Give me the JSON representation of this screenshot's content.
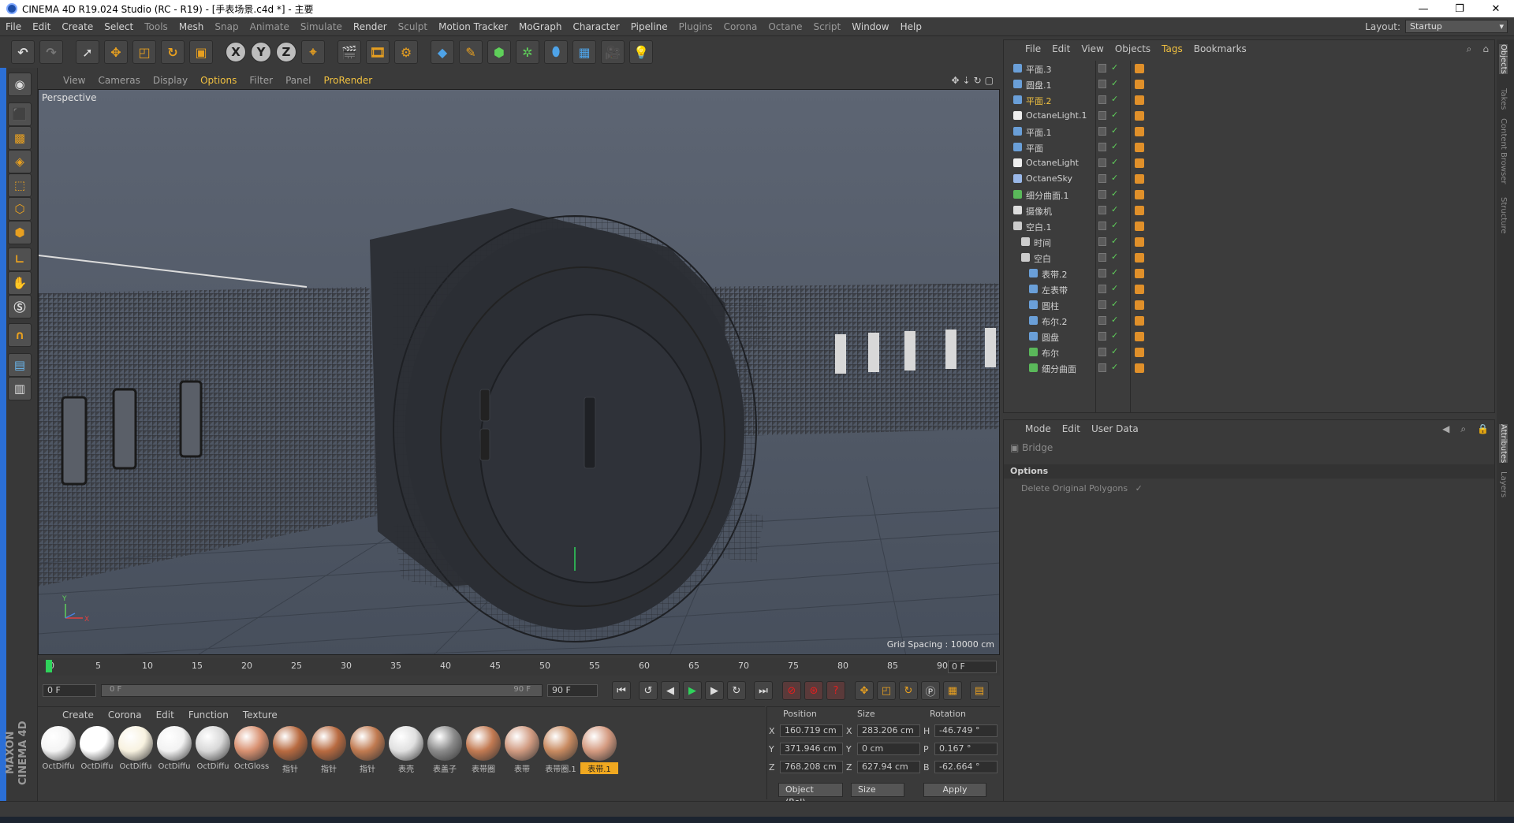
{
  "window": {
    "title": "CINEMA 4D R19.024 Studio (RC - R19) - [手表场景.c4d *] - 主要",
    "minimize": "—",
    "maximize": "❐",
    "close": "✕"
  },
  "menu": {
    "items": [
      "File",
      "Edit",
      "Create",
      "Select",
      "Tools",
      "Mesh",
      "Snap",
      "Animate",
      "Simulate",
      "Render",
      "Sculpt",
      "Motion Tracker",
      "MoGraph",
      "Character",
      "Pipeline",
      "Plugins",
      "Corona",
      "Octane",
      "Script",
      "Window",
      "Help"
    ],
    "layout_label": "Layout:",
    "layout_value": "Startup"
  },
  "toolbar": {
    "axis": [
      "X",
      "Y",
      "Z"
    ]
  },
  "viewport": {
    "menu": [
      "View",
      "Cameras",
      "Display",
      "Options",
      "Filter",
      "Panel",
      "ProRender"
    ],
    "label": "Perspective",
    "grid_spacing": "Grid Spacing : 10000 cm",
    "axis_y": "Y",
    "axis_x": "X"
  },
  "timeline": {
    "ticks": [
      "0",
      "5",
      "10",
      "15",
      "20",
      "25",
      "30",
      "35",
      "40",
      "45",
      "50",
      "55",
      "60",
      "65",
      "70",
      "75",
      "80",
      "85",
      "90"
    ],
    "frame_end": "0 F",
    "start": "0 F",
    "slider_start": "0 F",
    "slider_end": "90 F",
    "end": "90 F"
  },
  "materials": {
    "menu": [
      "Create",
      "Corona",
      "Edit",
      "Function",
      "Texture"
    ],
    "items": [
      {
        "name": "OctDiffu",
        "color": "#f4f4f4"
      },
      {
        "name": "OctDiffu",
        "color": "#ffffff"
      },
      {
        "name": "OctDiffu",
        "color": "#f8f2e0"
      },
      {
        "name": "OctDiffu",
        "color": "#f2f2f2"
      },
      {
        "name": "OctDiffu",
        "color": "#d8d8d8"
      },
      {
        "name": "OctGloss",
        "color": "#d89070"
      },
      {
        "name": "指针",
        "color": "#b86a40"
      },
      {
        "name": "指针",
        "color": "#b86a40"
      },
      {
        "name": "指针",
        "color": "#c07a50"
      },
      {
        "name": "表壳",
        "color": "#e0e0e0"
      },
      {
        "name": "表盖子",
        "color": "#8a8a8a"
      },
      {
        "name": "表带圈",
        "color": "#c27a52"
      },
      {
        "name": "表带",
        "color": "#d09a80"
      },
      {
        "name": "表带圈.1",
        "color": "#c88a60"
      },
      {
        "name": "表带.1",
        "color": "#d49a80"
      }
    ],
    "selected_index": 14
  },
  "coords": {
    "headers": [
      "Position",
      "Size",
      "Rotation"
    ],
    "rows": [
      {
        "axis": "X",
        "pos": "160.719 cm",
        "size_axis": "X",
        "size": "283.206 cm",
        "rot_axis": "H",
        "rot": "-46.749 °"
      },
      {
        "axis": "Y",
        "pos": "371.946 cm",
        "size_axis": "Y",
        "size": "0 cm",
        "rot_axis": "P",
        "rot": "0.167 °"
      },
      {
        "axis": "Z",
        "pos": "768.208 cm",
        "size_axis": "Z",
        "size": "627.94 cm",
        "rot_axis": "B",
        "rot": "-62.664 °"
      }
    ],
    "mode": "Object (Rel)",
    "size_mode": "Size",
    "apply": "Apply"
  },
  "objects": {
    "menu": [
      "File",
      "Edit",
      "View",
      "Objects",
      "Tags",
      "Bookmarks"
    ],
    "rows": [
      {
        "name": "平面.3",
        "indent": 0,
        "icon": "#6a9fd8",
        "hl": false
      },
      {
        "name": "圆盘.1",
        "indent": 0,
        "icon": "#6a9fd8",
        "hl": false
      },
      {
        "name": "平面.2",
        "indent": 0,
        "icon": "#6a9fd8",
        "hl": true
      },
      {
        "name": "OctaneLight.1",
        "indent": 0,
        "icon": "#eeeeee",
        "hl": false
      },
      {
        "name": "平面.1",
        "indent": 0,
        "icon": "#6a9fd8",
        "hl": false
      },
      {
        "name": "平面",
        "indent": 0,
        "icon": "#6a9fd8",
        "hl": false
      },
      {
        "name": "OctaneLight",
        "indent": 0,
        "icon": "#eeeeee",
        "hl": false
      },
      {
        "name": "OctaneSky",
        "indent": 0,
        "icon": "#9ab8e8",
        "hl": false
      },
      {
        "name": "细分曲面.1",
        "indent": 0,
        "icon": "#5ab85a",
        "hl": false
      },
      {
        "name": "摄像机",
        "indent": 0,
        "icon": "#dddddd",
        "hl": false
      },
      {
        "name": "空白.1",
        "indent": 0,
        "icon": "#cccccc",
        "hl": false
      },
      {
        "name": "时间",
        "indent": 1,
        "icon": "#cccccc",
        "hl": false
      },
      {
        "name": "空白",
        "indent": 1,
        "icon": "#cccccc",
        "hl": false
      },
      {
        "name": "表带.2",
        "indent": 2,
        "icon": "#6a9fd8",
        "hl": false
      },
      {
        "name": "左表带",
        "indent": 2,
        "icon": "#6a9fd8",
        "hl": false
      },
      {
        "name": "圆柱",
        "indent": 2,
        "icon": "#6a9fd8",
        "hl": false
      },
      {
        "name": "布尔.2",
        "indent": 2,
        "icon": "#6a9fd8",
        "hl": false
      },
      {
        "name": "圆盘",
        "indent": 2,
        "icon": "#6a9fd8",
        "hl": false
      },
      {
        "name": "布尔",
        "indent": 2,
        "icon": "#5ab85a",
        "hl": false
      },
      {
        "name": "细分曲面",
        "indent": 2,
        "icon": "#5ab85a",
        "hl": false
      }
    ]
  },
  "attributes": {
    "menu": [
      "Mode",
      "Edit",
      "User Data"
    ],
    "mode_name": "Bridge",
    "section": "Options",
    "field": "Delete Original Polygons",
    "check": "✓"
  },
  "right_tabs": [
    "Objects",
    "Takes",
    "Content Browser",
    "Structure",
    "Attributes",
    "Layers"
  ]
}
